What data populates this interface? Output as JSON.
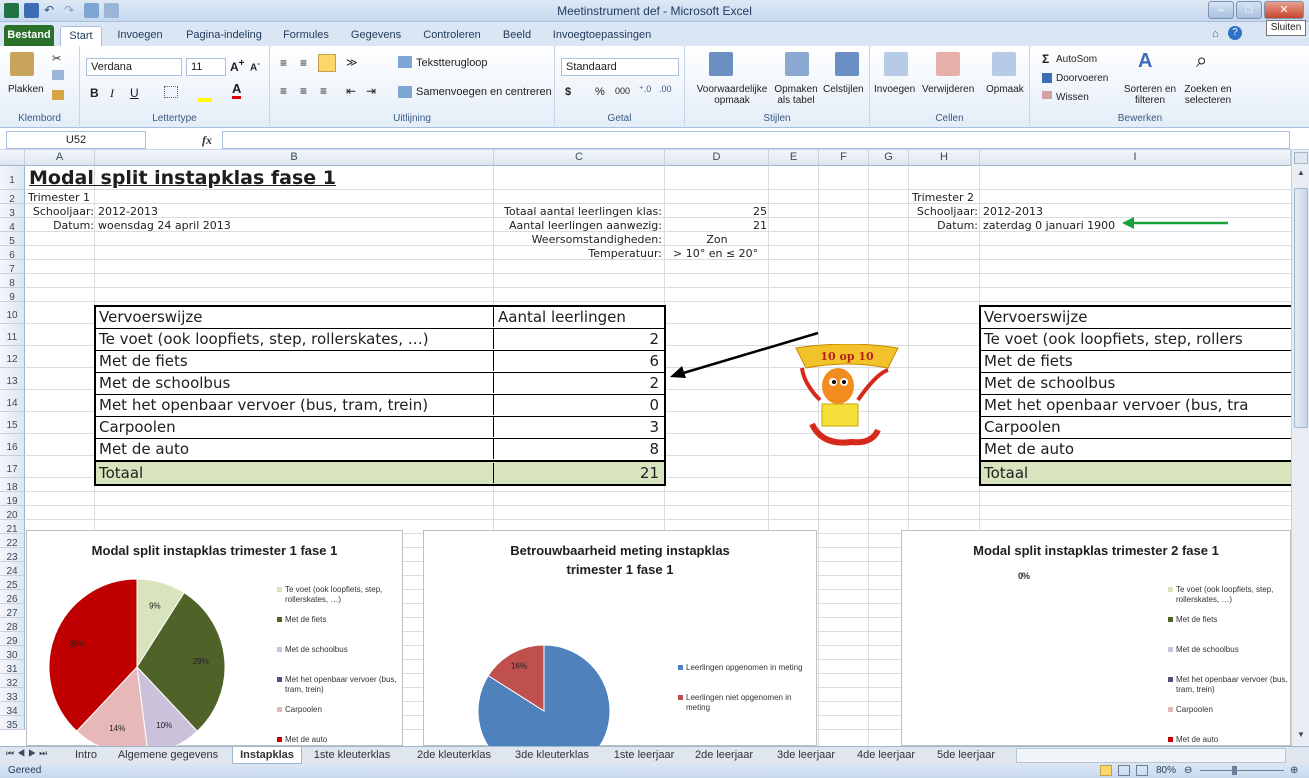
{
  "window": {
    "title": "Meetinstrument def - Microsoft Excel",
    "tooltip": "Sluiten"
  },
  "ribbon_tabs": [
    "Bestand",
    "Start",
    "Invoegen",
    "Pagina-indeling",
    "Formules",
    "Gegevens",
    "Controleren",
    "Beeld",
    "Invoegtoepassingen"
  ],
  "ribbon": {
    "paste": "Plakken",
    "clipboard_group": "Klembord",
    "font_name": "Verdana",
    "font_size": "11",
    "bold": "B",
    "italic": "I",
    "underline": "U",
    "font_group": "Lettertype",
    "wrap": "Tekstterugloop",
    "merge": "Samenvoegen en centreren",
    "align_group": "Uitlijning",
    "number_format": "Standaard",
    "currency": "$",
    "percent": "%",
    "thousands": "000",
    "number_group": "Getal",
    "cond_format": "Voorwaardelijke opmaak",
    "format_table": "Opmaken als tabel",
    "cell_styles": "Celstijlen",
    "styles_group": "Stijlen",
    "insert": "Invoegen",
    "delete": "Verwijderen",
    "format": "Opmaak",
    "cells_group": "Cellen",
    "autosum": "AutoSom",
    "fill": "Doorvoeren",
    "clear": "Wissen",
    "sort": "Sorteren en filteren",
    "find": "Zoeken en selecteren",
    "edit_group": "Bewerken"
  },
  "formula_bar": {
    "name_box": "U52",
    "fx": "fx",
    "value": ""
  },
  "columns": [
    "A",
    "B",
    "C",
    "D",
    "E",
    "F",
    "G",
    "H",
    "I"
  ],
  "rows": [
    "1",
    "2",
    "3",
    "4",
    "5",
    "6",
    "7",
    "8",
    "9",
    "10",
    "11",
    "12",
    "13",
    "14",
    "15",
    "16",
    "17",
    "18",
    "19",
    "20",
    "21",
    "22",
    "23",
    "24",
    "25",
    "26",
    "27",
    "28",
    "29",
    "30",
    "31",
    "32",
    "33",
    "34",
    "35"
  ],
  "sheet": {
    "title": "Modal split instapklas fase 1",
    "t1": {
      "trimester": "Trimester 1",
      "schooljaar_label": "Schooljaar:",
      "schooljaar": "2012-2013",
      "datum_label": "Datum:",
      "datum": "woensdag 24 april 2013"
    },
    "info": {
      "totaal_label": "Totaal aantal leerlingen klas:",
      "totaal": "25",
      "aanwezig_label": "Aantal leerlingen aanwezig:",
      "aanwezig": "21",
      "weer_label": "Weersomstandigheden:",
      "weer": "Zon",
      "temp_label": "Temperatuur:",
      "temp": "> 10° en ≤ 20°"
    },
    "t2": {
      "trimester": "Trimester 2",
      "schooljaar_label": "Schooljaar:",
      "schooljaar": "2012-2013",
      "datum_label": "Datum:",
      "datum": "zaterdag 0 januari 1900"
    },
    "table1": {
      "header": [
        "Vervoerswijze",
        "Aantal leerlingen"
      ],
      "rows": [
        [
          "Te voet (ook loopfiets, step, rollerskates, …)",
          "2"
        ],
        [
          "Met de fiets",
          "6"
        ],
        [
          "Met de schoolbus",
          "2"
        ],
        [
          "Met het openbaar vervoer (bus, tram, trein)",
          "0"
        ],
        [
          "Carpoolen",
          "3"
        ],
        [
          "Met de auto",
          "8"
        ]
      ],
      "total": [
        "Totaal",
        "21"
      ]
    },
    "table2": {
      "header": "Vervoerswijze",
      "rows": [
        "Te voet (ook loopfiets, step, rollers",
        "Met de fiets",
        "Met de schoolbus",
        "Met het openbaar vervoer (bus, tra",
        "Carpoolen",
        "Met de auto"
      ],
      "total": "Totaal"
    },
    "badge": "10 op 10"
  },
  "chart_data": [
    {
      "type": "pie",
      "title": "Modal split instapklas trimester 1 fase 1",
      "categories": [
        "Te voet (ook loopfiets, step, rollerskates, …)",
        "Met de fiets",
        "Met de schoolbus",
        "Met het openbaar vervoer (bus, tram, trein)",
        "Carpoolen",
        "Met de auto"
      ],
      "values": [
        9,
        29,
        10,
        0,
        14,
        38
      ],
      "labels": [
        "9%",
        "29%",
        "10%",
        "",
        "14%",
        "38%"
      ],
      "colors": [
        "#d7e4bd",
        "#4f6228",
        "#ccc1da",
        "#604a7b",
        "#e6b9b8",
        "#c00000"
      ],
      "legend": "right"
    },
    {
      "type": "pie",
      "title": "Betrouwbaarheid meting instapklas trimester 1 fase 1",
      "categories": [
        "Leerlingen opgenomen in meting",
        "Leerlingen niet opgenomen in meting"
      ],
      "values": [
        84,
        16
      ],
      "labels": [
        "84%",
        "16%"
      ],
      "colors": [
        "#4f81bd",
        "#c0504d"
      ],
      "legend": "right"
    },
    {
      "type": "pie",
      "title": "Modal split instapklas trimester 2 fase 1",
      "categories": [
        "Te voet (ook loopfiets, step, rollerskates, …)",
        "Met de fiets",
        "Met de schoolbus",
        "Met het openbaar vervoer (bus, tram, trein)",
        "Carpoolen",
        "Met de auto"
      ],
      "values": [],
      "labels": [
        "0%"
      ],
      "colors": [
        "#d7e4bd",
        "#4f6228",
        "#ccc1da",
        "#604a7b",
        "#e6b9b8",
        "#c00000"
      ],
      "legend": "right"
    }
  ],
  "sheet_tabs": [
    "Intro",
    "Algemene gegevens",
    "Instapklas",
    "1ste kleuterklas",
    "2de kleuterklas",
    "3de kleuterklas",
    "1ste leerjaar",
    "2de leerjaar",
    "3de leerjaar",
    "4de leerjaar",
    "5de leerjaar"
  ],
  "status": {
    "ready": "Gereed",
    "zoom": "80%"
  }
}
